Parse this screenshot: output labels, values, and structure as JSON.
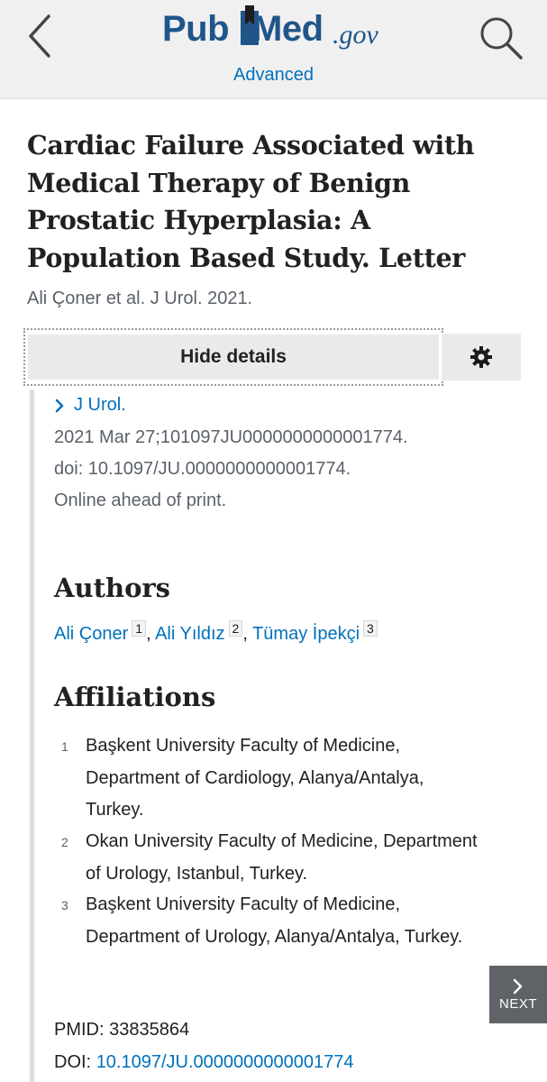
{
  "header": {
    "logo": {
      "part1": "Pub",
      "part2": "Med",
      "part3": ".gov"
    },
    "advanced_label": "Advanced",
    "icons": {
      "back": "chevron-left-icon",
      "search": "magnifier-icon"
    }
  },
  "article": {
    "title": "Cardiac Failure Associated with Medical Therapy of Benign Prostatic Hyperplasia: A Population Based Study. Letter",
    "short_citation": "Ali Çoner et al. J Urol. 2021."
  },
  "details": {
    "hide_label": "Hide details",
    "settings_icon": "gear-icon",
    "journal": "J Urol.",
    "date_line": "2021 Mar 27;101097JU0000000000001774.",
    "doi_line": "doi: 10.1097/JU.0000000000001774.",
    "status_line": "Online ahead of print."
  },
  "authors": {
    "heading": "Authors",
    "list": [
      {
        "name": "Ali Çoner",
        "sup": "1"
      },
      {
        "name": "Ali Yıldız",
        "sup": "2"
      },
      {
        "name": "Tümay İpekçi",
        "sup": "3"
      }
    ],
    "separator": ","
  },
  "affiliations": {
    "heading": "Affiliations",
    "list": [
      {
        "num": "1",
        "text": "Başkent University Faculty of Medicine, Department of Cardiology, Alanya/Antalya, Turkey."
      },
      {
        "num": "2",
        "text": "Okan University Faculty of Medicine, Department of Urology, Istanbul, Turkey."
      },
      {
        "num": "3",
        "text": "Başkent University Faculty of Medicine, Department of Urology, Alanya/Antalya, Turkey."
      }
    ]
  },
  "identifiers": {
    "pmid_label": "PMID: 33835864",
    "doi_label": "DOI:",
    "doi_value": "10.1097/JU.0000000000001774"
  },
  "next_button": {
    "label": "NEXT",
    "icon": "chevron-right-icon"
  },
  "colors": {
    "brand": "#20558a",
    "link": "#0071bc",
    "header_bg": "#f0f0f0",
    "muted": "#5b616b"
  }
}
